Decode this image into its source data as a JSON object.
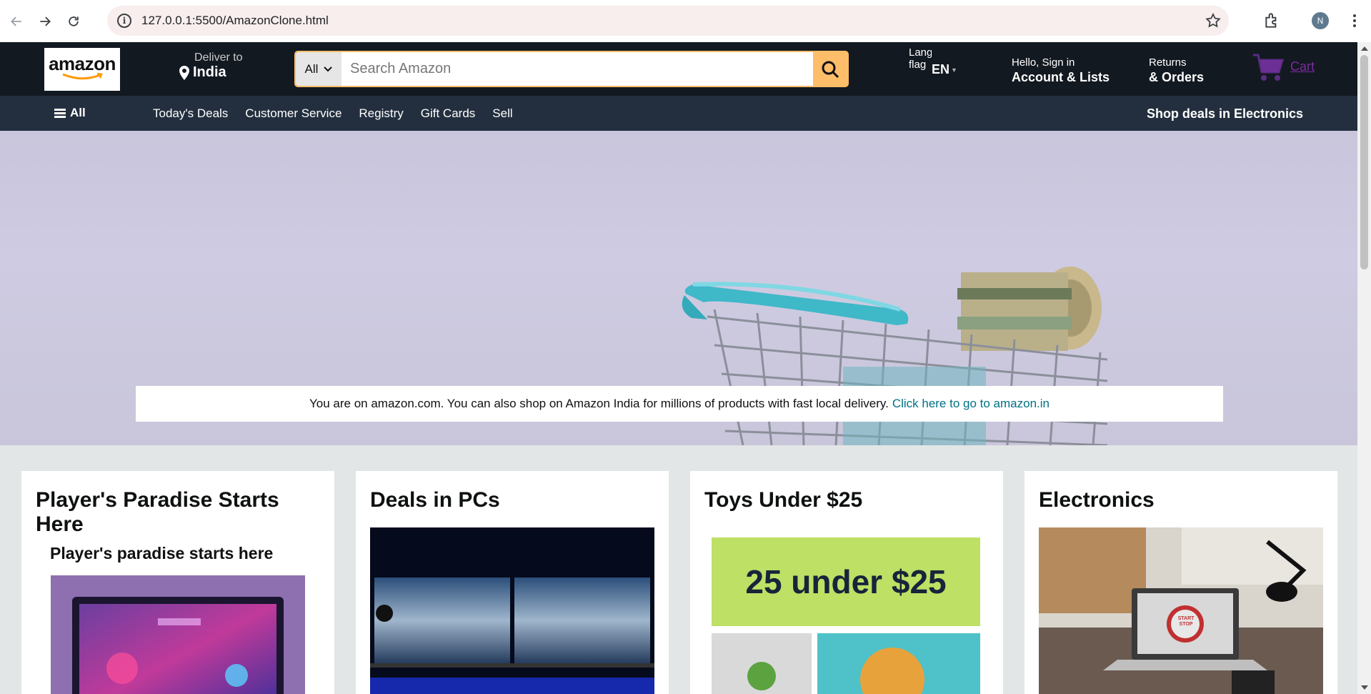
{
  "browser": {
    "url": "127.0.0.1:5500/AmazonClone.html",
    "profile_initial": "N"
  },
  "header": {
    "logo_text": "amazon",
    "deliver_label": "Deliver to",
    "deliver_location": "India",
    "search_category": "All",
    "search_placeholder": "Search Amazon",
    "flag_alt": "Language flag",
    "language": "EN",
    "account_greeting": "Hello, Sign in",
    "account_label": "Account & Lists",
    "returns_label": "Returns",
    "orders_label": "& Orders",
    "cart_label": "Cart"
  },
  "subnav": {
    "all_label": "All",
    "links": [
      "Today's Deals",
      "Customer Service",
      "Registry",
      "Gift Cards",
      "Sell"
    ],
    "promo": "Shop deals in Electronics"
  },
  "hero": {
    "notice_text": "You are on amazon.com. You can also shop on Amazon India for millions of products with fast local delivery.",
    "notice_link": "Click here to go to amazon.in"
  },
  "cards": [
    {
      "title": "Player's Paradise Starts Here",
      "subtitle": "Player's paradise starts here"
    },
    {
      "title": "Deals in PCs"
    },
    {
      "title": "Toys Under $25",
      "banner_text": "25 under $25"
    },
    {
      "title": "Electronics",
      "sign_text": "START STOP"
    }
  ],
  "colors": {
    "header_bg": "#131921",
    "subnav_bg": "#232f3e",
    "search_button": "#febd69",
    "link": "#007185",
    "cart": "#7b2c9f"
  }
}
